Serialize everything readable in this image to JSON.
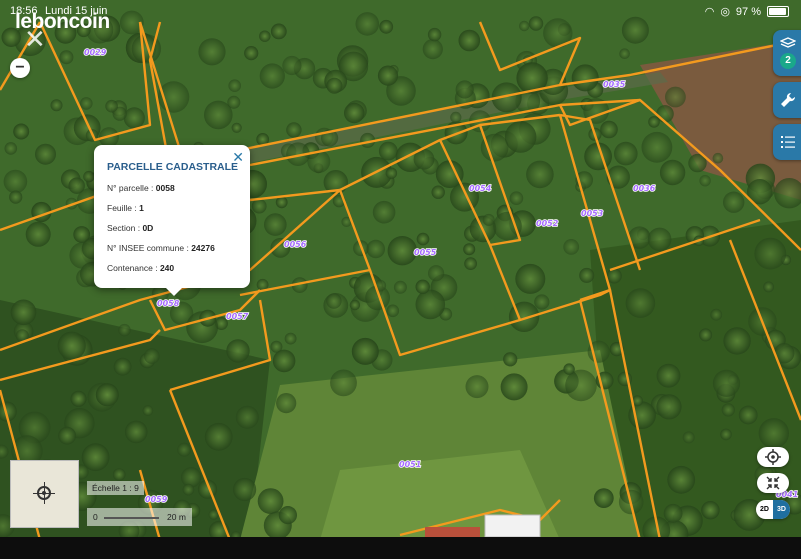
{
  "status": {
    "time": "18:56",
    "date": "Lundi 15 juin",
    "battery": "97 %",
    "battery_level": 0.97
  },
  "brand": {
    "name": "leboncoin"
  },
  "controls": {
    "zoom_out_label": "−",
    "layers_badge": "2",
    "close_icon": "close-icon",
    "layers_icon": "layers-icon",
    "tools_icon": "wrench-icon",
    "legend_icon": "list-icon"
  },
  "popup": {
    "title": "PARCELLE CADASTRALE",
    "rows": [
      {
        "label": "N° parcelle : ",
        "value": "0058"
      },
      {
        "label": "Feuille : ",
        "value": "1"
      },
      {
        "label": "Section : ",
        "value": "0D"
      },
      {
        "label": "N° INSEE commune : ",
        "value": "24276"
      },
      {
        "label": "Contenance : ",
        "value": "240"
      }
    ]
  },
  "parcels": [
    "0029",
    "0035",
    "0036",
    "0054",
    "0053",
    "0052",
    "0055",
    "0056",
    "0057",
    "0058",
    "0051",
    "0059",
    "0041"
  ],
  "scale": {
    "label": "Échelle 1 :",
    "ratio_fragment": "9",
    "zero": "0",
    "distance": "20 m"
  },
  "view_toggle": {
    "option_2d": "2D",
    "option_3d": "3D",
    "selected": "3D"
  },
  "colors": {
    "parcel_line": "#f39a1e",
    "accent": "#2a79a8",
    "parcel_label": "#a66cff"
  }
}
